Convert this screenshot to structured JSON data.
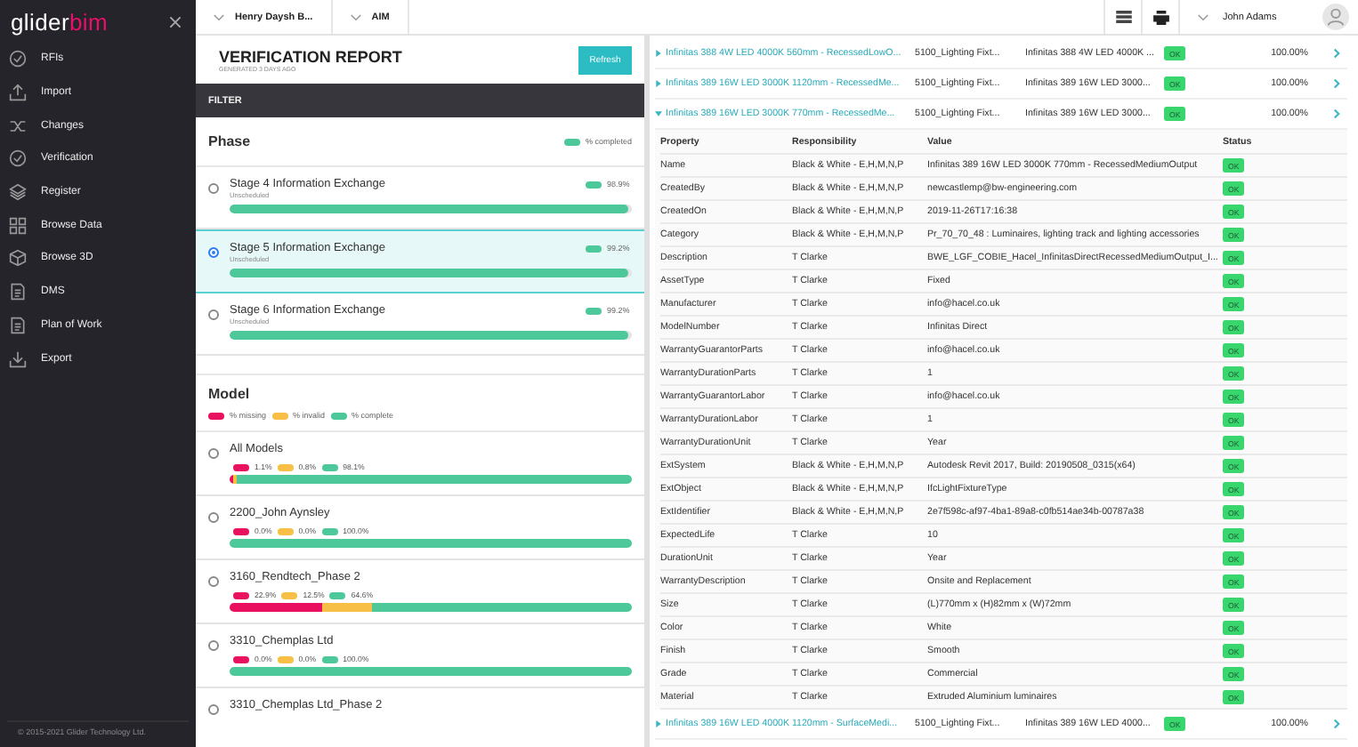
{
  "sidebar": {
    "logo": {
      "part_1": "glider",
      "part_2": "bim"
    },
    "items": [
      {
        "label": "RFIs"
      },
      {
        "label": "Import"
      },
      {
        "label": "Changes"
      },
      {
        "label": "Verification"
      },
      {
        "label": "Register"
      },
      {
        "label": "Browse Data"
      },
      {
        "label": "Browse 3D"
      },
      {
        "label": "DMS"
      },
      {
        "label": "Plan of Work"
      },
      {
        "label": "Export"
      }
    ],
    "footer": "© 2015-2021 Glider Technology Ltd."
  },
  "topbar": {
    "breadcrumbs": [
      "Henry Daysh B...",
      "AIM"
    ],
    "user": "John Adams"
  },
  "report": {
    "title": "VERIFICATION REPORT",
    "subtitle": "GENERATED 3 DAYS AGO",
    "refresh_button": "Refresh",
    "filter_label": "FILTER",
    "phase": {
      "heading": "Phase",
      "legend": "% completed",
      "items": [
        {
          "name": "Stage 4 Information Exchange",
          "status": "Unscheduled",
          "percent": "98.9%",
          "level": 0.989,
          "selected": false
        },
        {
          "name": "Stage 5 Information Exchange",
          "status": "Unscheduled",
          "percent": "99.2%",
          "level": 0.992,
          "selected": true
        },
        {
          "name": "Stage 6 Information Exchange",
          "status": "Unscheduled",
          "percent": "99.2%",
          "level": 0.992,
          "selected": false
        }
      ]
    },
    "model": {
      "heading": "Model",
      "legend": [
        {
          "kind": "missing",
          "label": "% missing"
        },
        {
          "kind": "invalid",
          "label": "% invalid"
        },
        {
          "kind": "complete",
          "label": "% complete"
        }
      ],
      "items": [
        {
          "name": "All Models",
          "selected": false,
          "segments": [
            {
              "kind": "missing",
              "label": "1.1%"
            },
            {
              "kind": "invalid",
              "label": "0.8%"
            },
            {
              "kind": "complete",
              "label": "98.1%"
            }
          ]
        },
        {
          "name": "2200_John Aynsley",
          "selected": false,
          "segments": [
            {
              "kind": "missing",
              "label": "0.0%"
            },
            {
              "kind": "invalid",
              "label": "0.0%"
            },
            {
              "kind": "complete",
              "label": "100.0%"
            }
          ]
        },
        {
          "name": "3160_Rendtech_Phase 2",
          "selected": false,
          "segments": [
            {
              "kind": "missing",
              "label": "22.9%"
            },
            {
              "kind": "invalid",
              "label": "12.5%"
            },
            {
              "kind": "complete",
              "label": "64.6%"
            }
          ]
        },
        {
          "name": "3310_Chemplas Ltd",
          "selected": false,
          "segments": [
            {
              "kind": "missing",
              "label": "0.0%"
            },
            {
              "kind": "invalid",
              "label": "0.0%"
            },
            {
              "kind": "complete",
              "label": "100.0%"
            }
          ]
        },
        {
          "name": "3310_Chemplas Ltd_Phase 2",
          "selected": false
        }
      ]
    }
  },
  "objects": [
    {
      "name": "Infinitas 388 4W LED 4000K 560mm - RecessedLowO...",
      "column_2": "5100_Lighting Fixt...",
      "column_3": "Infinitas 388 4W LED 4000K ...",
      "status": "OK",
      "percent": "100.00%",
      "expanded": false
    },
    {
      "name": "Infinitas 389 16W LED 3000K 1120mm - RecessedMe...",
      "column_2": "5100_Lighting Fixt...",
      "column_3": "Infinitas 389 16W LED 3000...",
      "status": "OK",
      "percent": "100.00%",
      "expanded": false
    },
    {
      "name": "Infinitas 389 16W LED 3000K 770mm - RecessedMe...",
      "column_2": "5100_Lighting Fixt...",
      "column_3": "Infinitas 389 16W LED 3000...",
      "status": "OK",
      "percent": "100.00%",
      "expanded": true,
      "properties": {
        "columns": [
          "Property",
          "Responsibility",
          "Value",
          "Status"
        ],
        "rows": [
          {
            "property": "Name",
            "responsibility": "Black & White - E,H,M,N,P",
            "value": "Infinitas 389 16W LED 3000K 770mm - RecessedMediumOutput",
            "status": "OK"
          },
          {
            "property": "CreatedBy",
            "responsibility": "Black & White - E,H,M,N,P",
            "value": "newcastlemp@bw-engineering.com",
            "status": "OK"
          },
          {
            "property": "CreatedOn",
            "responsibility": "Black & White - E,H,M,N,P",
            "value": "2019-11-26T17:16:38",
            "status": "OK"
          },
          {
            "property": "Category",
            "responsibility": "Black & White - E,H,M,N,P",
            "value": "Pr_70_70_48 : Luminaires, lighting track and lighting accessories",
            "status": "OK"
          },
          {
            "property": "Description",
            "responsibility": "T Clarke",
            "value": "BWE_LGF_COBIE_Hacel_InfinitasDirectRecessedMediumOutput_I...",
            "status": "OK"
          },
          {
            "property": "AssetType",
            "responsibility": "T Clarke",
            "value": "Fixed",
            "status": "OK"
          },
          {
            "property": "Manufacturer",
            "responsibility": "T Clarke",
            "value": "info@hacel.co.uk",
            "status": "OK"
          },
          {
            "property": "ModelNumber",
            "responsibility": "T Clarke",
            "value": "Infinitas Direct",
            "status": "OK"
          },
          {
            "property": "WarrantyGuarantorParts",
            "responsibility": "T Clarke",
            "value": "info@hacel.co.uk",
            "status": "OK"
          },
          {
            "property": "WarrantyDurationParts",
            "responsibility": "T Clarke",
            "value": "1",
            "status": "OK"
          },
          {
            "property": "WarrantyGuarantorLabor",
            "responsibility": "T Clarke",
            "value": "info@hacel.co.uk",
            "status": "OK"
          },
          {
            "property": "WarrantyDurationLabor",
            "responsibility": "T Clarke",
            "value": "1",
            "status": "OK"
          },
          {
            "property": "WarrantyDurationUnit",
            "responsibility": "T Clarke",
            "value": "Year",
            "status": "OK"
          },
          {
            "property": "ExtSystem",
            "responsibility": "Black & White - E,H,M,N,P",
            "value": "Autodesk Revit 2017, Build: 20190508_0315(x64)",
            "status": "OK"
          },
          {
            "property": "ExtObject",
            "responsibility": "Black & White - E,H,M,N,P",
            "value": "IfcLightFixtureType",
            "status": "OK"
          },
          {
            "property": "ExtIdentifier",
            "responsibility": "Black & White - E,H,M,N,P",
            "value": "2e7f598c-af97-4ba1-89a8-c0fb514ae34b-00787a38",
            "status": "OK"
          },
          {
            "property": "ExpectedLife",
            "responsibility": "T Clarke",
            "value": "10",
            "status": "OK"
          },
          {
            "property": "DurationUnit",
            "responsibility": "T Clarke",
            "value": "Year",
            "status": "OK"
          },
          {
            "property": "WarrantyDescription",
            "responsibility": "T Clarke",
            "value": "Onsite and Replacement",
            "status": "OK"
          },
          {
            "property": "Size",
            "responsibility": "T Clarke",
            "value": "(L)770mm x (H)82mm x (W)72mm",
            "status": "OK"
          },
          {
            "property": "Color",
            "responsibility": "T Clarke",
            "value": "White",
            "status": "OK"
          },
          {
            "property": "Finish",
            "responsibility": "T Clarke",
            "value": "Smooth",
            "status": "OK"
          },
          {
            "property": "Grade",
            "responsibility": "T Clarke",
            "value": "Commercial",
            "status": "OK"
          },
          {
            "property": "Material",
            "responsibility": "T Clarke",
            "value": "Extruded Aluminium luminaires",
            "status": "OK"
          }
        ]
      }
    },
    {
      "name": "Infinitas 389 16W LED 4000K 1120mm - SurfaceMedi...",
      "column_2": "5100_Lighting Fixt...",
      "column_3": "Infinitas 389 16W LED 4000...",
      "status": "OK",
      "percent": "100.00%",
      "expanded": false
    }
  ]
}
